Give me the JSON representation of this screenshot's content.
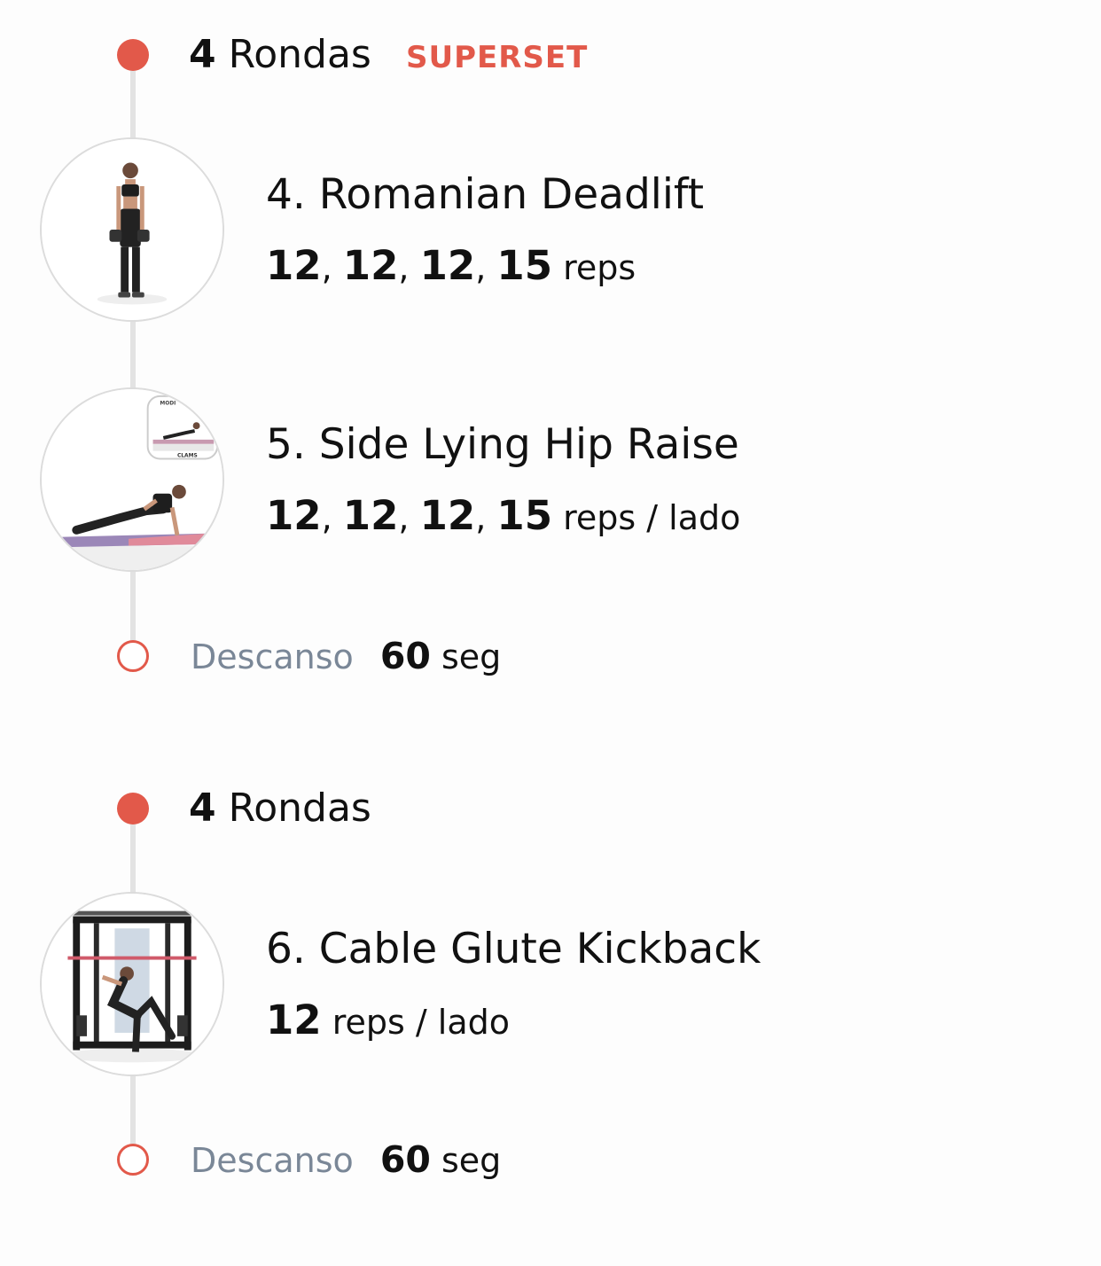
{
  "rounds": [
    {
      "count": "4",
      "label": "Rondas",
      "tag": "SUPERSET"
    },
    {
      "count": "4",
      "label": "Rondas",
      "tag": ""
    }
  ],
  "exercises": [
    {
      "title": "4. Romanian Deadlift",
      "reps": [
        "12",
        "12",
        "12",
        "15"
      ],
      "unit": "reps"
    },
    {
      "title": "5. Side Lying Hip Raise",
      "reps": [
        "12",
        "12",
        "12",
        "15"
      ],
      "unit": "reps / lado",
      "inset_label": "CLAMS",
      "inset_caption": "MODI"
    },
    {
      "title": "6. Cable Glute Kickback",
      "reps": [
        "12"
      ],
      "unit": "reps / lado"
    }
  ],
  "rests": [
    {
      "label": "Descanso",
      "value": "60",
      "unit": "seg"
    },
    {
      "label": "Descanso",
      "value": "60",
      "unit": "seg"
    }
  ],
  "colors": {
    "accent": "#e2594a",
    "muted": "#7a8797",
    "timeline": "#e3e3e3"
  }
}
